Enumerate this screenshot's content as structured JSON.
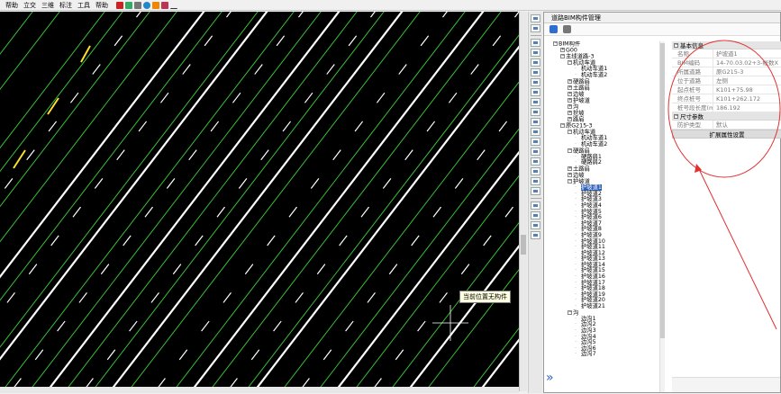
{
  "menubar": {
    "items": [
      "帮助",
      "立交",
      "三维",
      "标注",
      "工具",
      "帮助"
    ]
  },
  "panel": {
    "title": "道路BIM构件管理",
    "tabs": [
      "3d-view-icon",
      "list-icon"
    ]
  },
  "tree": {
    "items": [
      {
        "indent": 0,
        "exp": "-",
        "label": "BIM构件"
      },
      {
        "indent": 1,
        "exp": "+",
        "label": "G00"
      },
      {
        "indent": 1,
        "exp": "-",
        "label": "主线道路-3"
      },
      {
        "indent": 2,
        "exp": "-",
        "label": "机动车道"
      },
      {
        "indent": 3,
        "exp": "",
        "label": "机动车道1"
      },
      {
        "indent": 3,
        "exp": "",
        "label": "机动车道2"
      },
      {
        "indent": 2,
        "exp": "+",
        "label": "硬路肩"
      },
      {
        "indent": 2,
        "exp": "+",
        "label": "土路肩"
      },
      {
        "indent": 2,
        "exp": "+",
        "label": "边坡"
      },
      {
        "indent": 2,
        "exp": "+",
        "label": "护坡道"
      },
      {
        "indent": 2,
        "exp": "+",
        "label": "沟"
      },
      {
        "indent": 2,
        "exp": "+",
        "label": "挖坡"
      },
      {
        "indent": 2,
        "exp": "+",
        "label": "路肩"
      },
      {
        "indent": 1,
        "exp": "-",
        "label": "原G215-3"
      },
      {
        "indent": 2,
        "exp": "-",
        "label": "机动车道"
      },
      {
        "indent": 3,
        "exp": "",
        "label": "机动车道1"
      },
      {
        "indent": 3,
        "exp": "",
        "label": "机动车道2"
      },
      {
        "indent": 2,
        "exp": "-",
        "label": "硬路肩"
      },
      {
        "indent": 3,
        "exp": "",
        "label": "硬路肩1"
      },
      {
        "indent": 3,
        "exp": "",
        "label": "硬路肩2"
      },
      {
        "indent": 2,
        "exp": "+",
        "label": "土路肩"
      },
      {
        "indent": 2,
        "exp": "+",
        "label": "边坡"
      },
      {
        "indent": 2,
        "exp": "-",
        "label": "护坡道"
      },
      {
        "indent": 3,
        "exp": "",
        "label": "护坡道1",
        "selected": true
      },
      {
        "indent": 3,
        "exp": "",
        "label": "护坡道2"
      },
      {
        "indent": 3,
        "exp": "",
        "label": "护坡道3"
      },
      {
        "indent": 3,
        "exp": "",
        "label": "护坡道4"
      },
      {
        "indent": 3,
        "exp": "",
        "label": "护坡道5"
      },
      {
        "indent": 3,
        "exp": "",
        "label": "护坡道6"
      },
      {
        "indent": 3,
        "exp": "",
        "label": "护坡道7"
      },
      {
        "indent": 3,
        "exp": "",
        "label": "护坡道8"
      },
      {
        "indent": 3,
        "exp": "",
        "label": "护坡道9"
      },
      {
        "indent": 3,
        "exp": "",
        "label": "护坡道10"
      },
      {
        "indent": 3,
        "exp": "",
        "label": "护坡道11"
      },
      {
        "indent": 3,
        "exp": "",
        "label": "护坡道12"
      },
      {
        "indent": 3,
        "exp": "",
        "label": "护坡道13"
      },
      {
        "indent": 3,
        "exp": "",
        "label": "护坡道14"
      },
      {
        "indent": 3,
        "exp": "",
        "label": "护坡道15"
      },
      {
        "indent": 3,
        "exp": "",
        "label": "护坡道16"
      },
      {
        "indent": 3,
        "exp": "",
        "label": "护坡道17"
      },
      {
        "indent": 3,
        "exp": "",
        "label": "护坡道18"
      },
      {
        "indent": 3,
        "exp": "",
        "label": "护坡道19"
      },
      {
        "indent": 3,
        "exp": "",
        "label": "护坡道20"
      },
      {
        "indent": 3,
        "exp": "",
        "label": "护坡道21"
      },
      {
        "indent": 2,
        "exp": "-",
        "label": "沟"
      },
      {
        "indent": 3,
        "exp": "",
        "label": "边沟1"
      },
      {
        "indent": 3,
        "exp": "",
        "label": "边沟2"
      },
      {
        "indent": 3,
        "exp": "",
        "label": "边沟3"
      },
      {
        "indent": 3,
        "exp": "",
        "label": "边沟4"
      },
      {
        "indent": 3,
        "exp": "",
        "label": "边沟5"
      },
      {
        "indent": 3,
        "exp": "",
        "label": "边沟6"
      },
      {
        "indent": 3,
        "exp": "",
        "label": "边沟7"
      }
    ]
  },
  "props": {
    "basic_title": "基本信息",
    "basic_rows": [
      {
        "k": "名称",
        "v": "护坡道1"
      },
      {
        "k": "BIM编码",
        "v": "14-70.03.02+3-帐数X"
      },
      {
        "k": "所属道路",
        "v": "原G215-3"
      },
      {
        "k": "位于道路",
        "v": "左侧"
      },
      {
        "k": "起点桩号",
        "v": "K101+75.98"
      },
      {
        "k": "终点桩号",
        "v": "K101+262.172"
      },
      {
        "k": "桩号段长度(m)",
        "v": "186.192"
      }
    ],
    "size_title": "尺寸参数",
    "size_rows": [
      {
        "k": "防护类型",
        "v": "默认"
      }
    ],
    "ext_button": "扩展属性设置"
  },
  "tooltip": "当前位置无构件",
  "colors": {
    "road_green": "#3bd23b",
    "road_white": "#ffffff",
    "road_yellow": "#ffe02a",
    "annotation_red": "#e23030",
    "selection_blue": "#2d5fb8"
  }
}
